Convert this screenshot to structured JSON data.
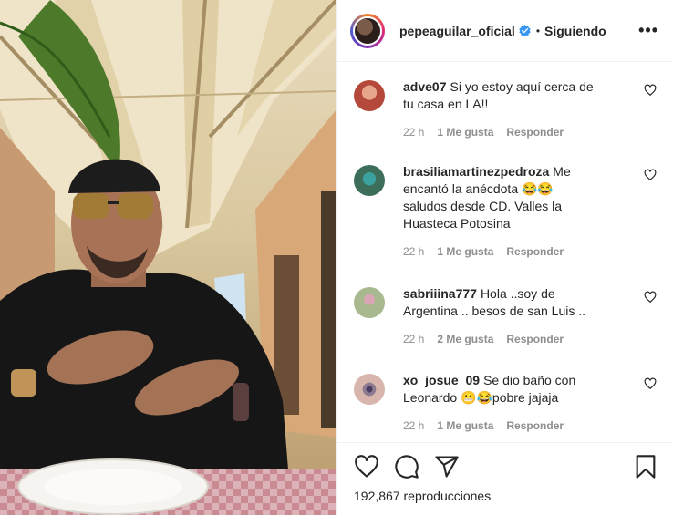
{
  "header": {
    "username": "pepeaguilar_oficial",
    "verified": true,
    "separator": "•",
    "follow_label": "Siguiendo",
    "more_label": "•••"
  },
  "comments": [
    {
      "user": "adve07",
      "text": "Si yo estoy aquí cerca de tu casa en LA!!",
      "time": "22 h",
      "likes": "1 Me gusta",
      "reply": "Responder",
      "avatar_color": "#b4483a"
    },
    {
      "user": "brasiliamartinezpedroza",
      "text": "Me encantó la anécdota 😂😂 saludos desde CD. Valles la Huasteca Potosina",
      "time": "22 h",
      "likes": "1 Me gusta",
      "reply": "Responder",
      "avatar_color": "#3c6e5a"
    },
    {
      "user": "sabriiina777",
      "text": "Hola ..soy de Argentina .. besos de san Luis ..",
      "time": "22 h",
      "likes": "2 Me gusta",
      "reply": "Responder",
      "avatar_color": "#a9b98f"
    },
    {
      "user": "xo_josue_09",
      "text": "Se dio baño con Leonardo 😬😂pobre jajaja",
      "time": "22 h",
      "likes": "1 Me gusta",
      "reply": "Responder",
      "avatar_color": "#d9b6ad"
    }
  ],
  "actions": {
    "like_icon": "heart-outline-icon",
    "comment_icon": "comment-bubble-icon",
    "share_icon": "paper-plane-icon",
    "save_icon": "bookmark-icon"
  },
  "stats": {
    "views": "192,867 reproducciones"
  },
  "colors": {
    "verified_blue": "#3897f0",
    "meta_gray": "#8e8e8e",
    "text": "#262626"
  }
}
